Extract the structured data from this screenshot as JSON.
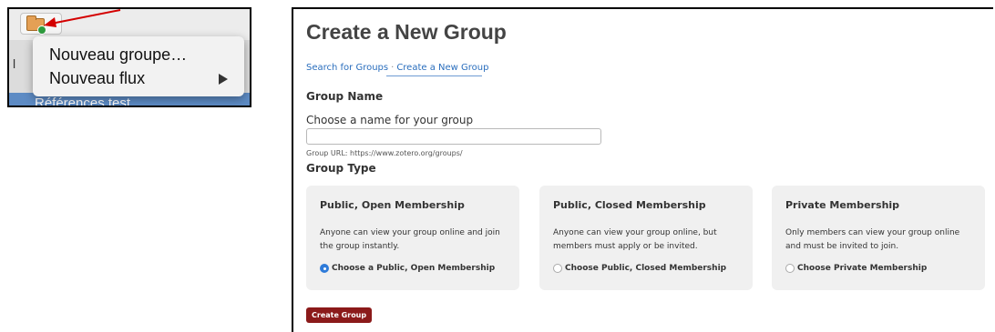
{
  "zotero_menu": {
    "new_group_label": "Nouveau groupe…",
    "new_feed_label": "Nouveau flux",
    "sidebar_visible_letter": "l",
    "selected_library_label": "Références test"
  },
  "page": {
    "title": "Create a New Group",
    "breadcrumb": {
      "first": "Search for Groups",
      "separator": "·",
      "second": "Create a New Group"
    },
    "group_name_heading": "Group Name",
    "name_field_label": "Choose a name for your group",
    "name_field_value": "",
    "group_url": "Group URL: https://www.zotero.org/groups/",
    "group_type_heading": "Group Type",
    "options": [
      {
        "title": "Public, Open Membership",
        "description": "Anyone can view your group online and join the group instantly.",
        "radio_label": "Choose a Public, Open Membership",
        "selected": true
      },
      {
        "title": "Public, Closed Membership",
        "description": "Anyone can view your group online, but members must apply or be invited.",
        "radio_label": "Choose Public, Closed Membership",
        "selected": false
      },
      {
        "title": "Private Membership",
        "description": "Only members can view your group online and must be invited to join.",
        "radio_label": "Choose Private Membership",
        "selected": false
      }
    ],
    "create_button_label": "Create Group"
  },
  "colors": {
    "accent_red": "#8b1a1a",
    "link_blue": "#2a6ebd",
    "radio_selected": "#2f7bd9",
    "annotation_arrow": "#d40000"
  },
  "icons": {
    "toolbar_button": "new-collection-folder-icon",
    "submenu_arrow": "triangle-right-icon"
  }
}
